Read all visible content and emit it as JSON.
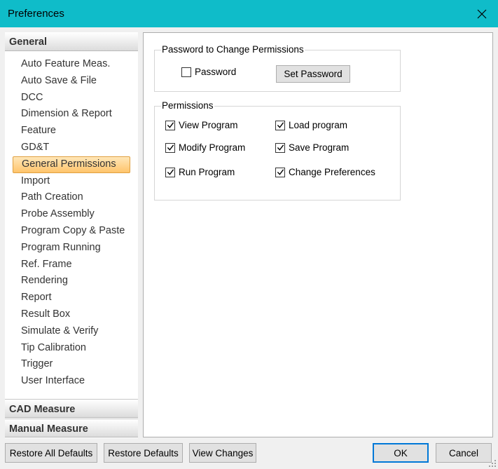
{
  "window": {
    "title": "Preferences"
  },
  "sidebar": {
    "general_header": "General",
    "items": [
      {
        "label": "Auto Feature Meas."
      },
      {
        "label": "Auto Save & File"
      },
      {
        "label": "DCC"
      },
      {
        "label": "Dimension & Report"
      },
      {
        "label": "Feature"
      },
      {
        "label": "GD&T"
      },
      {
        "label": "General Permissions",
        "selected": true
      },
      {
        "label": "Import"
      },
      {
        "label": "Path Creation"
      },
      {
        "label": "Probe Assembly"
      },
      {
        "label": "Program Copy & Paste"
      },
      {
        "label": "Program Running"
      },
      {
        "label": "Ref. Frame"
      },
      {
        "label": "Rendering"
      },
      {
        "label": "Report"
      },
      {
        "label": "Result Box"
      },
      {
        "label": "Simulate & Verify"
      },
      {
        "label": "Tip Calibration"
      },
      {
        "label": "Trigger"
      },
      {
        "label": "User Interface"
      }
    ],
    "cad_header": "CAD Measure",
    "manual_header": "Manual Measure"
  },
  "password_group": {
    "legend": "Password to Change Permissions",
    "password_label": "Password",
    "password_checked": false,
    "set_password_label": "Set Password"
  },
  "permissions_group": {
    "legend": "Permissions",
    "items": [
      {
        "label": "View Program",
        "checked": true
      },
      {
        "label": "Load program",
        "checked": true
      },
      {
        "label": "Modify Program",
        "checked": true
      },
      {
        "label": "Save Program",
        "checked": true
      },
      {
        "label": "Run Program",
        "checked": true
      },
      {
        "label": "Change Preferences",
        "checked": true
      }
    ]
  },
  "footer": {
    "restore_all_label": "Restore All Defaults",
    "restore_label": "Restore Defaults",
    "view_changes_label": "View Changes",
    "ok_label": "OK",
    "cancel_label": "Cancel"
  }
}
